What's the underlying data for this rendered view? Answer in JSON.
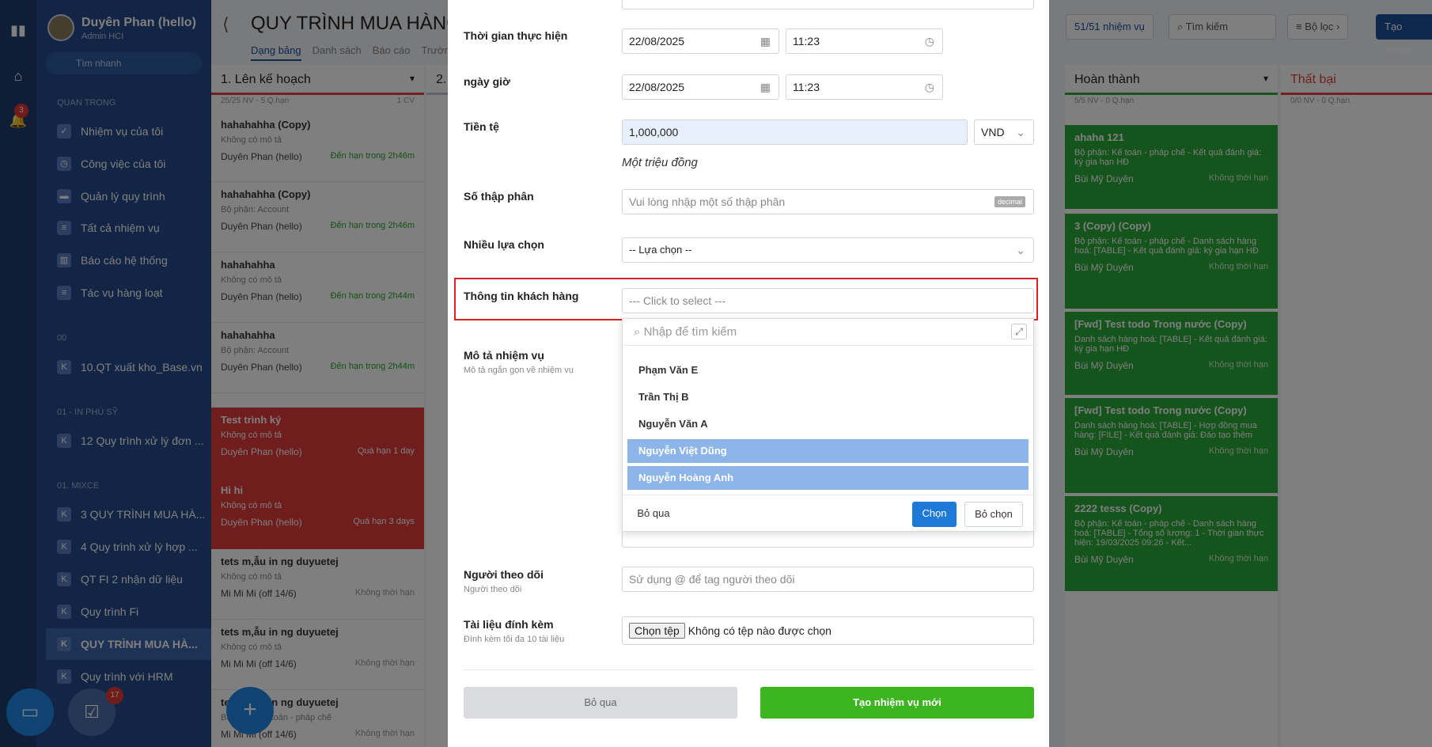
{
  "rail": {
    "bell_badge": "3"
  },
  "user": {
    "name": "Duyên Phan (hello)",
    "role": "Admin HCI"
  },
  "sidebar": {
    "search_placeholder": "Tìm nhanh",
    "sections": [
      "QUAN TRỌNG",
      "00",
      "01 - IN PHÚ SỸ",
      "01. MIXCE"
    ],
    "items": [
      "Nhiệm vụ của tôi",
      "Công việc của tôi",
      "Quản lý quy trình",
      "Tất cả nhiệm vụ",
      "Báo cáo hệ thống",
      "Tác vụ hàng loạt",
      "10.QT xuất kho_Base.vn",
      "12 Quy trình xử lý đơn ...",
      "3 QUY TRÌNH MUA HÀ...",
      "4 Quy trình xử lý hợp ...",
      "QT FI 2 nhận dữ liệu",
      "Quy trình Fi",
      "QUY TRÌNH MUA HÀ...",
      "Quy trình với HRM"
    ],
    "fab_badge": "17"
  },
  "header": {
    "title": "QUY TRÌNH MUA HÀNG",
    "tabs": [
      "Dạng bảng",
      "Danh sách",
      "Báo cáo",
      "Trườn"
    ],
    "count": "51/51 nhiệm vụ",
    "search": "Tìm kiếm",
    "filter": "Bộ lọc",
    "create": "Tạo nhiệm"
  },
  "col1": {
    "title": "1. Lên kế hoạch",
    "sub": "25/25 NV - 5 Q.hạn",
    "cv": "1 CV",
    "cards": [
      {
        "t": "hahahahha (Copy)",
        "d": "Không có mô tả",
        "u": "Duyên Phan (hello)",
        "due": "Đến hạn trong 2h46m"
      },
      {
        "t": "hahahahha (Copy)",
        "d": "Bộ phận: Account",
        "u": "Duyên Phan (hello)",
        "due": "Đến hạn trong 2h46m"
      },
      {
        "t": "hahahahha",
        "d": "Không có mô tả",
        "u": "Duyên Phan (hello)",
        "due": "Đến hạn trong 2h44m"
      },
      {
        "t": "hahahahha",
        "d": "Bộ phận: Account",
        "u": "Duyên Phan (hello)",
        "due": "Đến hạn trong 2h44m"
      },
      {
        "t": "Test trình ký",
        "d": "Không có mô tả",
        "u": "Duyên Phan (hello)",
        "due": "Quá hạn 1 day"
      },
      {
        "t": "Hi hi",
        "d": "Không có mô tả",
        "u": "Duyên Phan (hello)",
        "due": "Quá hạn 3 days"
      },
      {
        "t": "tets m,ẫu in ng duyuetej",
        "d": "Không có mô tả",
        "u": "Mi Mi Mi (off 14/6)",
        "due": "Không thời hạn"
      },
      {
        "t": "tets m,ẫu in ng duyuetej",
        "d": "Không có mô tả",
        "u": "Mi Mi Mi (off 14/6)",
        "due": "Không thời hạn"
      },
      {
        "t": "tets m,ẫu in ng duyuetej",
        "d": "Bộ phận: Kế toán - pháp chế",
        "u": "Mi Mi Mi (off 14/6)",
        "due": "Không thời hạn"
      }
    ]
  },
  "col_done": {
    "title": "Hoàn thành",
    "sub": "5/5 NV - 0 Q.hạn",
    "cards": [
      {
        "t": "ahaha 121",
        "d": "Bộ phận: Kế toán - pháp chế - Kết quả đánh giá: ký gia hạn HĐ",
        "u": "Bùi Mỹ Duyên",
        "due": "Không thời hạn"
      },
      {
        "t": "3 (Copy) (Copy)",
        "d": "Bộ phận: Kế toán - pháp chế - Danh sách hàng hoá: [TABLE] - Kết quả đánh giá: ký gia hạn HĐ",
        "u": "Bùi Mỹ Duyên",
        "due": "Không thời hạn"
      },
      {
        "t": "[Fwd] Test todo Trong nước (Copy)",
        "d": "Danh sách hàng hoá: [TABLE] - Kết quả đánh giá: ký gia hạn HĐ",
        "u": "Bùi Mỹ Duyên",
        "due": "Không thời hạn"
      },
      {
        "t": "[Fwd] Test todo Trong nước (Copy)",
        "d": "Danh sách hàng hoá: [TABLE] - Hợp đồng mua hàng: [FILE] - Kết quả đánh giá: Đáo tạo thêm",
        "u": "Bùi Mỹ Duyên",
        "due": "Không thời hạn"
      },
      {
        "t": "2222 tesss (Copy)",
        "d": "Bộ phận: Kế toán - pháp chế - Danh sách hàng hoá: [TABLE] - Tổng số lượng: 1 - Thời gian thực hiện: 19/03/2025 09:26 - Kết...",
        "u": "Bùi Mỹ Duyên",
        "due": "Không thời hạn"
      }
    ]
  },
  "col_fail": {
    "title": "Thất bại",
    "sub": "0/0 NV - 0 Q.hạn"
  },
  "form": {
    "time_label": "Thời gian thực hiện",
    "date1": "22/08/2025",
    "time1": "11:23",
    "datetime_label": "ngày giờ",
    "date2": "22/08/2025",
    "time2": "11:23",
    "currency_label": "Tiền tệ",
    "currency_value": "1,000,000",
    "currency_unit": "VND",
    "currency_words": "Một triệu đồng",
    "decimal_label": "Số thập phân",
    "decimal_placeholder": "Vui lòng nhập một số thập phân",
    "decimal_tag": "decimal",
    "multi_label": "Nhiều lựa chọn",
    "multi_value": "-- Lựa chọn --",
    "customer_label": "Thông tin khách hàng",
    "customer_placeholder": "--- Click to select ---",
    "dropdown_search": "Nhập để tìm kiếm",
    "options": [
      "Phạm Văn E",
      "Trần Thị B",
      "Nguyễn Văn A",
      "Nguyễn Việt Dũng",
      "Nguyễn Hoàng Anh"
    ],
    "dd_skip": "Bỏ qua",
    "dd_choose": "Chọn",
    "dd_unchoose": "Bỏ chọn",
    "desc_label": "Mô tả nhiệm vụ",
    "desc_sub": "Mô tả ngắn gọn về nhiệm vụ",
    "follower_label": "Người theo dõi",
    "follower_sub": "Người theo dõi",
    "follower_placeholder": "Sử dụng @ để tag người theo dõi",
    "attach_label": "Tài liệu đính kèm",
    "attach_sub": "Đính kèm tối đa 10 tài liệu",
    "file_button": "Chọn tệp",
    "file_status": "Không có tệp nào được chọn",
    "cancel": "Bỏ qua",
    "submit": "Tạo nhiệm vụ mới"
  }
}
